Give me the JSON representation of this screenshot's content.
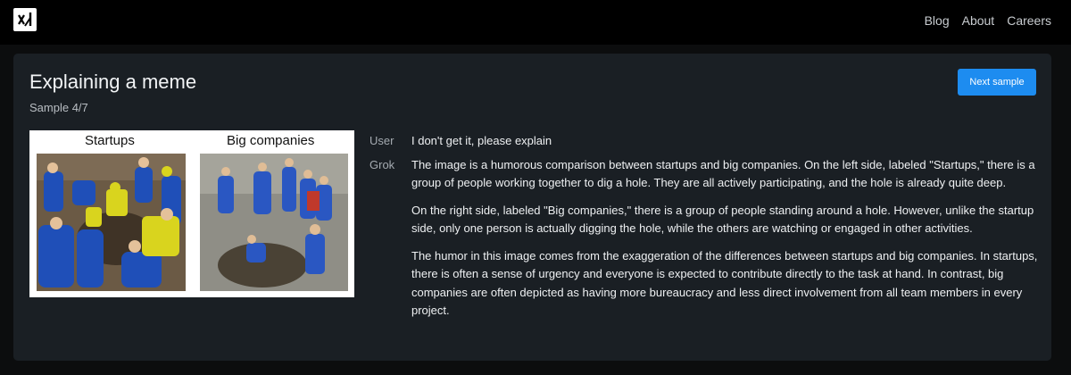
{
  "header": {
    "logo_icon": "xai-logo-icon",
    "nav": [
      {
        "label": "Blog"
      },
      {
        "label": "About"
      },
      {
        "label": "Careers"
      }
    ]
  },
  "sample": {
    "title": "Explaining a meme",
    "subtitle": "Sample 4/7",
    "next_button": "Next sample",
    "accent": "#1d8cf0"
  },
  "meme": {
    "left_label": "Startups",
    "right_label": "Big companies"
  },
  "conversation": {
    "user_role": "User",
    "user_message": "I don't get it, please explain",
    "assistant_role": "Grok",
    "assistant_paragraphs": [
      "The image is a humorous comparison between startups and big companies. On the left side, labeled \"Startups,\" there is a group of people working together to dig a hole. They are all actively participating, and the hole is already quite deep.",
      "On the right side, labeled \"Big companies,\" there is a group of people standing around a hole. However, unlike the startup side, only one person is actually digging the hole, while the others are watching or engaged in other activities.",
      "The humor in this image comes from the exaggeration of the differences between startups and big companies. In startups, there is often a sense of urgency and everyone is expected to contribute directly to the task at hand. In contrast, big companies are often depicted as having more bureaucracy and less direct involvement from all team members in every project."
    ]
  }
}
